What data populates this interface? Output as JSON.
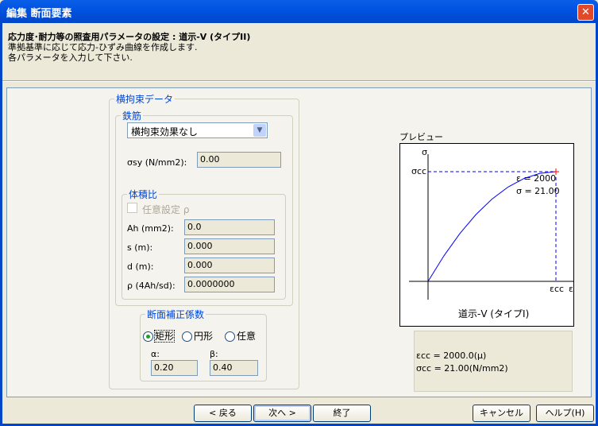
{
  "window": {
    "title": "編集 断面要素",
    "close": "✕"
  },
  "header": {
    "heading": "応力度･耐力等の照査用パラメータの設定 : 道示-V (タイプII)",
    "line1": "準拠基準に応じて応力-ひずみ曲線を作成します.",
    "line2": "各パラメータを入力して下さい."
  },
  "confinement": {
    "legend": "横拘束データ",
    "rebar": {
      "legend": "鉄筋",
      "select_value": "横拘束効果なし",
      "sigma_sy_label": "σsy (N/mm2):",
      "sigma_sy": "0.00"
    },
    "volume_ratio": {
      "legend": "体積比",
      "checkbox_label": "任意設定 ρ",
      "checked": false,
      "rows": [
        {
          "label": "Ah (mm2):",
          "value": "0.0"
        },
        {
          "label": "s (m):",
          "value": "0.000"
        },
        {
          "label": "d (m):",
          "value": "0.000"
        },
        {
          "label": "ρ (4Ah/sd):",
          "value": "0.0000000"
        }
      ]
    },
    "correction": {
      "legend": "断面補正係数",
      "options": [
        "矩形",
        "円形",
        "任意"
      ],
      "selected": "矩形",
      "alpha_label": "α:",
      "alpha": "0.20",
      "beta_label": "β:",
      "beta": "0.40"
    }
  },
  "preview": {
    "label": "プレビュー",
    "info_eps": "εcc = 2000.0(μ)",
    "info_sig": "σcc = 21.00(N/mm2)"
  },
  "chart_data": {
    "type": "line",
    "title": "道示-V (タイプI)",
    "xlabel": "ε",
    "ylabel": "σ",
    "x_tick": "εcc",
    "y_tick": "σcc",
    "annotation_eps": "ε = 2000",
    "annotation_sig": "σ = 21.00",
    "eps_cc": 2000,
    "sigma_cc": 21.0,
    "x": [
      0,
      250,
      500,
      750,
      1000,
      1250,
      1500,
      1750,
      2000
    ],
    "y": [
      0,
      4.92,
      9.19,
      12.8,
      15.75,
      18.05,
      19.69,
      20.67,
      21.0
    ],
    "line_color": "#0000ff"
  },
  "footer": {
    "back": "< 戻る",
    "next": "次へ >",
    "finish": "終了",
    "cancel": "キャンセル",
    "help": "ヘルプ(H)"
  }
}
